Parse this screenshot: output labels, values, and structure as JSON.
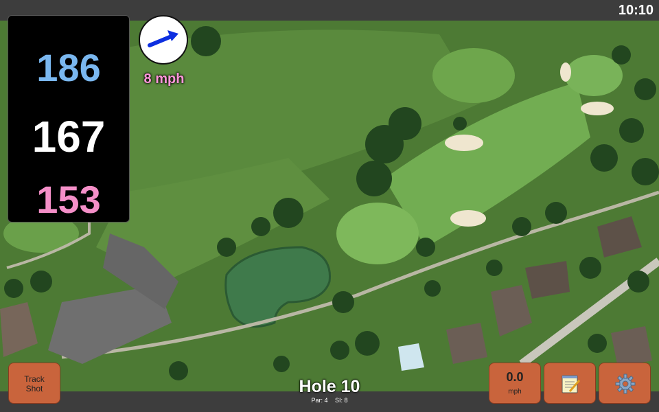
{
  "status_bar": {
    "time": "10:10"
  },
  "distances": {
    "back": "186",
    "center": "167",
    "front": "153"
  },
  "wind": {
    "speed": "8 mph",
    "direction_icon": "wind-arrow-icon"
  },
  "hole": {
    "title": "Hole 10",
    "par": "Par: 4",
    "stroke_index": "SI: 8"
  },
  "buttons": {
    "track_shot_line1": "Track",
    "track_shot_line2": "Shot",
    "speed_value": "0.0",
    "speed_unit": "mph",
    "notes_icon": "notepad-icon",
    "settings_icon": "gear-icon"
  },
  "colors": {
    "back_distance": "#7ab7ef",
    "center_distance": "#ffffff",
    "front_distance": "#f48fc8",
    "button": "#c9643c",
    "wind_speed": "#ff96d9"
  }
}
